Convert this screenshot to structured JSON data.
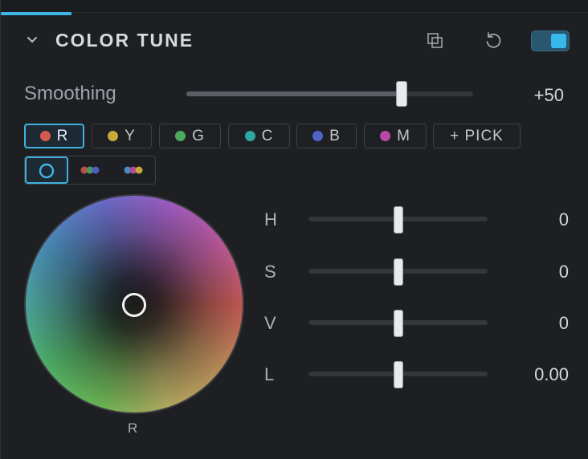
{
  "header": {
    "title": "COLOR TUNE",
    "icons": {
      "collapse": "chevron-down-icon",
      "compare": "compare-icon",
      "reset": "reset-icon"
    },
    "enabled": true
  },
  "smoothing": {
    "label": "Smoothing",
    "value": 50,
    "value_text": "+50",
    "min": -100,
    "max": 100
  },
  "channels": [
    {
      "label": "R",
      "color": "#d65a4e",
      "active": true
    },
    {
      "label": "Y",
      "color": "#c9a93a",
      "active": false
    },
    {
      "label": "G",
      "color": "#4aa95a",
      "active": false
    },
    {
      "label": "C",
      "color": "#2fa6a3",
      "active": false
    },
    {
      "label": "B",
      "color": "#4f63c9",
      "active": false
    },
    {
      "label": "M",
      "color": "#b34aa8",
      "active": false
    }
  ],
  "pick": {
    "label": "+ PICK"
  },
  "modes": [
    {
      "name": "single-wheel",
      "active": true
    },
    {
      "name": "three-dots",
      "active": false
    },
    {
      "name": "three-dots-alt",
      "active": false
    }
  ],
  "wheel": {
    "label": "R"
  },
  "params": [
    {
      "label": "H",
      "value_text": "0",
      "value": 0
    },
    {
      "label": "S",
      "value_text": "0",
      "value": 0
    },
    {
      "label": "V",
      "value_text": "0",
      "value": 0
    },
    {
      "label": "L",
      "value_text": "0.00",
      "value": 0
    }
  ],
  "colors": {
    "accent": "#3fb4e6",
    "background": "#1e1f22"
  }
}
